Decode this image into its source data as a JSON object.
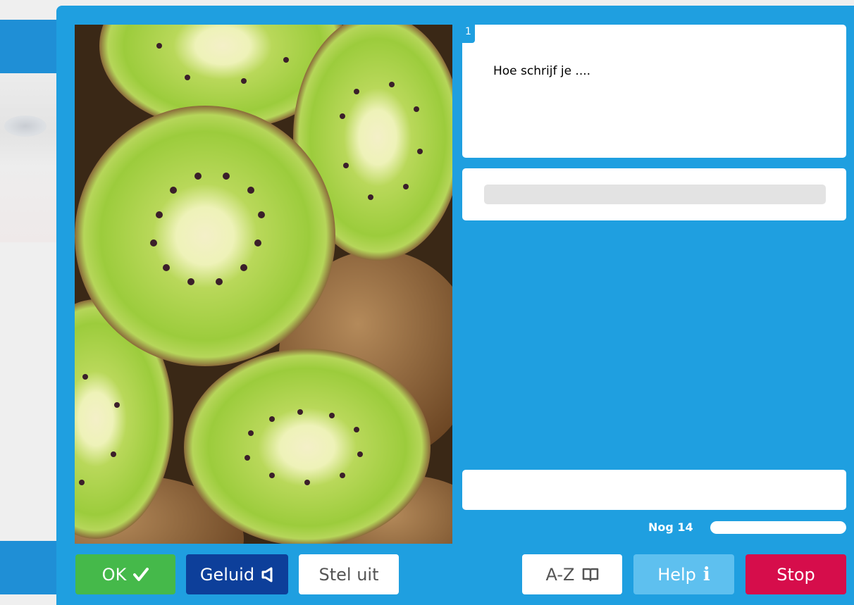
{
  "question": {
    "number": "1",
    "text": "Hoe schrijf je ...."
  },
  "answer": {
    "value": "",
    "placeholder": ""
  },
  "feedback": {
    "text": ""
  },
  "progress": {
    "label": "Nog 14",
    "remaining_fraction": 1.0
  },
  "buttons": {
    "ok": {
      "label": "OK",
      "icon": "check-icon"
    },
    "sound": {
      "label": "Geluid",
      "icon": "speaker-icon"
    },
    "postpone": {
      "label": "Stel uit"
    },
    "az": {
      "label": "A-Z",
      "icon": "book-icon"
    },
    "help": {
      "label": "Help",
      "icon": "info-icon",
      "icon_glyph": "i"
    },
    "stop": {
      "label": "Stop"
    }
  },
  "image": {
    "subject": "kiwi-halves-photo"
  },
  "colors": {
    "modal_background": "#1f9fe0",
    "ok": "#45b94a",
    "sound": "#0d3f9a",
    "help": "#5ec0ef",
    "stop": "#d60d4b"
  }
}
